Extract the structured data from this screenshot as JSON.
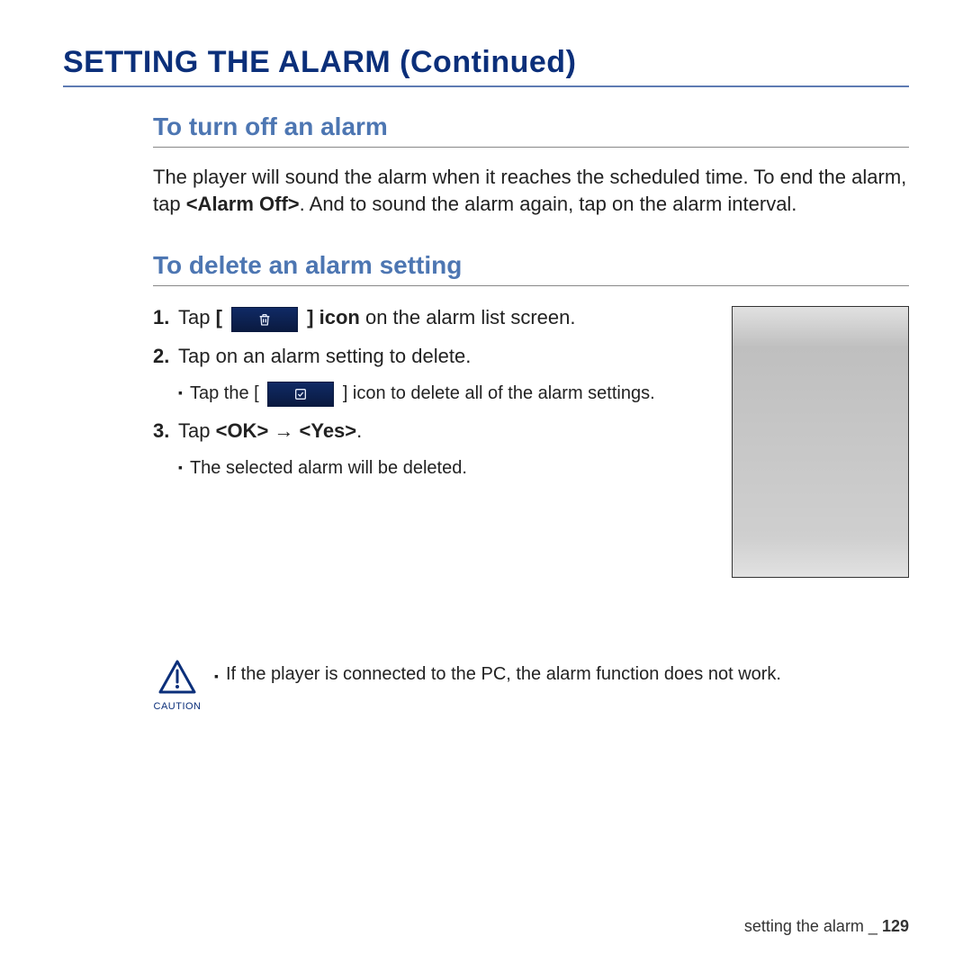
{
  "page_title": "SETTING THE ALARM (Continued)",
  "section1": {
    "heading": "To turn off an alarm",
    "text_before_bold": "The player will sound the alarm when it reaches the scheduled time. To end the alarm, tap ",
    "bold_label": "<Alarm Off>",
    "text_after_bold": ". And to sound the alarm again, tap on the alarm interval."
  },
  "section2": {
    "heading": "To delete an alarm setting",
    "steps": [
      {
        "num": "1.",
        "pre": "Tap ",
        "bracket_open": "[",
        "icon": "trash",
        "bracket_close": "]",
        "bold_after_icon": " icon",
        "post": " on the alarm list screen."
      },
      {
        "num": "2.",
        "text": "Tap on an alarm setting to delete.",
        "sub": {
          "pre": "Tap the [",
          "icon": "check",
          "post": "] icon to delete all of the alarm settings."
        }
      },
      {
        "num": "3.",
        "pre": "Tap ",
        "bold": "<OK> → <Yes>",
        "post": ".",
        "sub_text": "The selected alarm will be deleted."
      }
    ]
  },
  "caution": {
    "label": "CAUTION",
    "text": "If the player is connected to the PC, the alarm function does not work."
  },
  "footer": {
    "section_label": "setting the alarm _ ",
    "page_number": "129"
  }
}
